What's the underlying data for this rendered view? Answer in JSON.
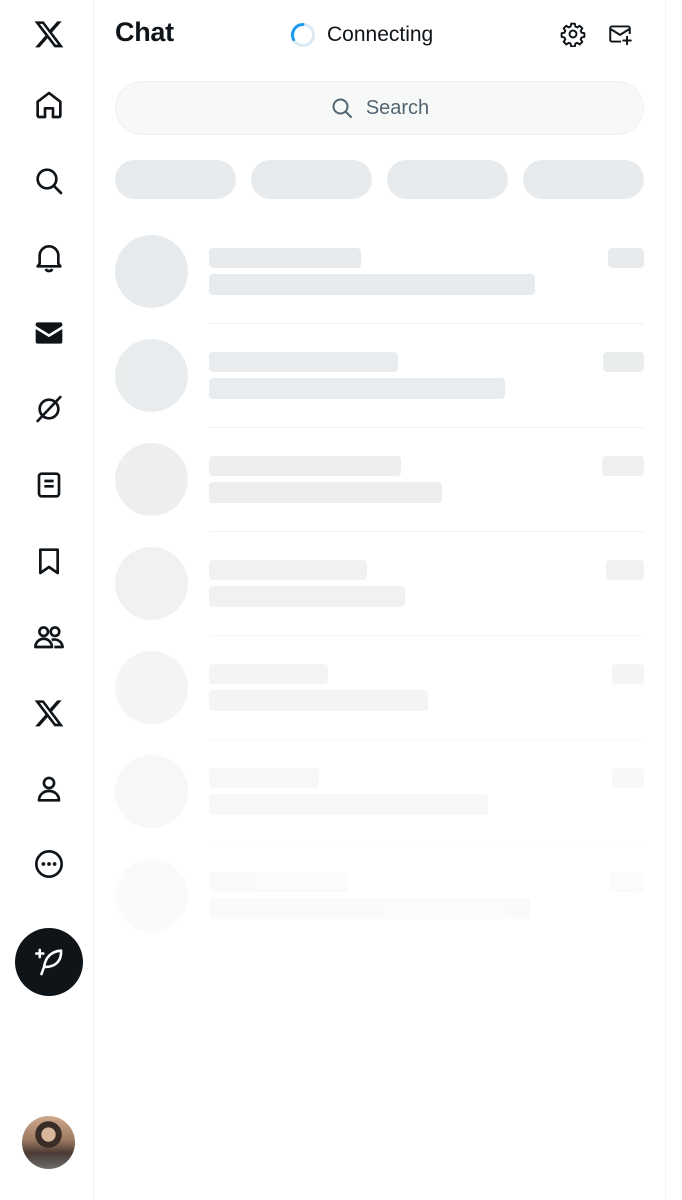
{
  "header": {
    "title": "Chat",
    "status_text": "Connecting"
  },
  "search": {
    "placeholder": "Search"
  },
  "nav": {
    "items": [
      "x-logo-icon",
      "home-icon",
      "search-icon",
      "bell-icon",
      "mail-icon",
      "grok-icon",
      "notes-icon",
      "bookmark-icon",
      "communities-icon",
      "premium-x-icon",
      "profile-icon",
      "more-icon"
    ],
    "compose": "compose-post-icon"
  },
  "colors": {
    "text": "#0f1419",
    "muted": "#536471",
    "skeleton": "#e8ebed",
    "spinner": "#1d9bf0",
    "compose_bg": "#0f1419"
  },
  "loading_rows": 7
}
